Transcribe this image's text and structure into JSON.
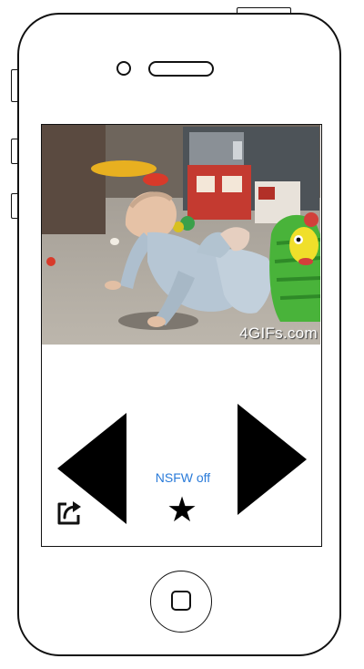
{
  "gif": {
    "watermark": "4GIFs.com"
  },
  "controls": {
    "nsfw_label": "NSFW off",
    "star_glyph": "★"
  },
  "icons": {
    "previous": "triangle-left-icon",
    "next": "triangle-right-icon",
    "favorite": "star-icon",
    "share": "share-icon"
  },
  "colors": {
    "nsfw_link": "#2a7bd9",
    "frame": "#111111"
  }
}
